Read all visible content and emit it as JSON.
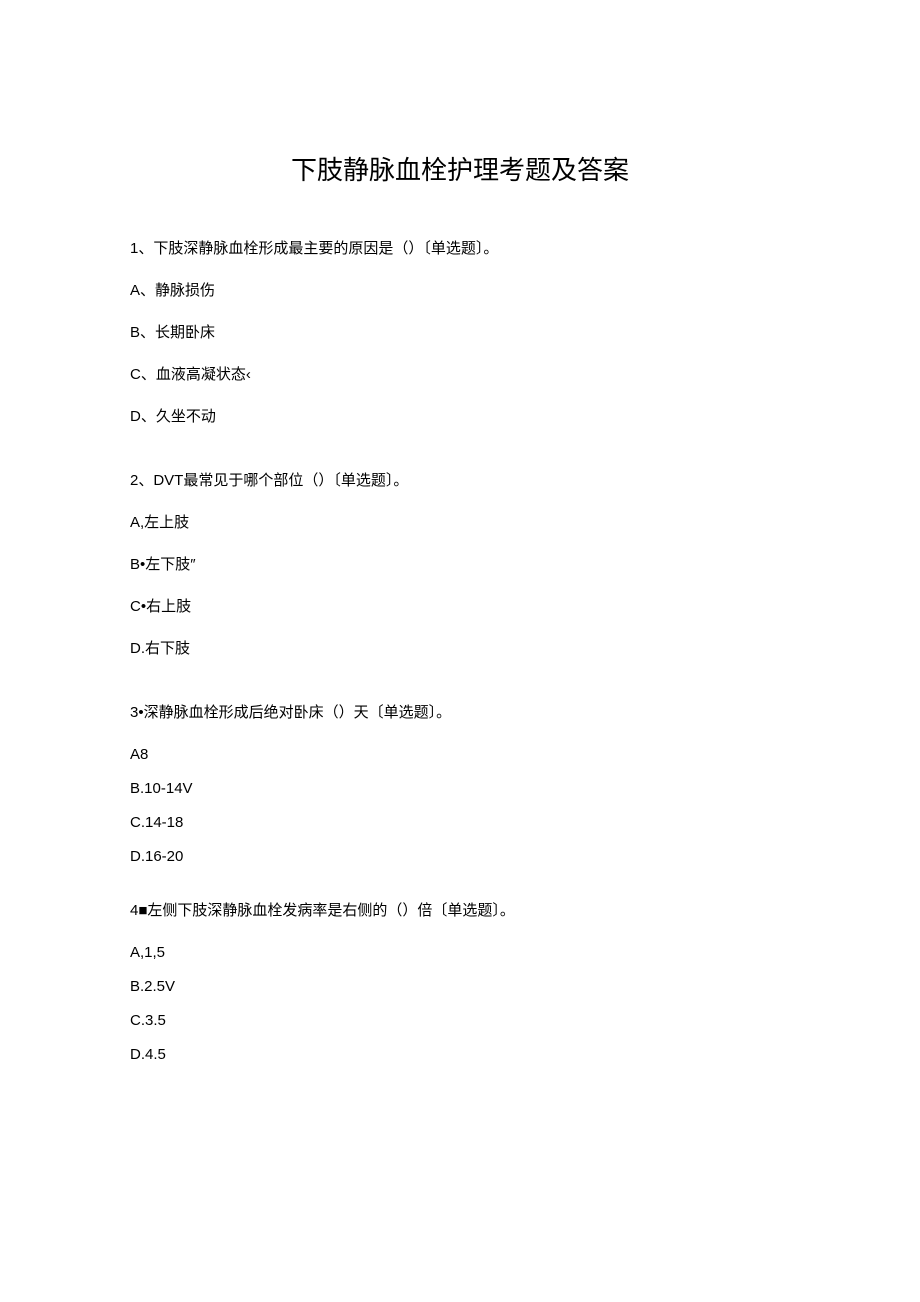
{
  "title": "下肢静脉血栓护理考题及答案",
  "questions": [
    {
      "text": "1、下肢深静脉血栓形成最主要的原因是（）〔单选题〕。",
      "options": [
        "A、静脉损伤",
        "B、长期卧床",
        "C、血液高凝状态‹",
        "D、久坐不动"
      ]
    },
    {
      "text": "2、DVT最常见于哪个部位（）〔单选题〕。",
      "options": [
        "A,左上肢",
        "B•左下肢″",
        "C•右上肢",
        "D.右下肢"
      ]
    },
    {
      "text": "3•深静脉血栓形成后绝对卧床（）天〔单选题〕。",
      "options": [
        "A8",
        "B.10-14V",
        "C.14-18",
        "D.16-20"
      ]
    },
    {
      "text": "4■左侧下肢深静脉血栓发病率是右侧的（）倍〔单选题〕。",
      "options": [
        "A,1,5",
        "B.2.5V",
        "C.3.5",
        "D.4.5"
      ]
    }
  ]
}
